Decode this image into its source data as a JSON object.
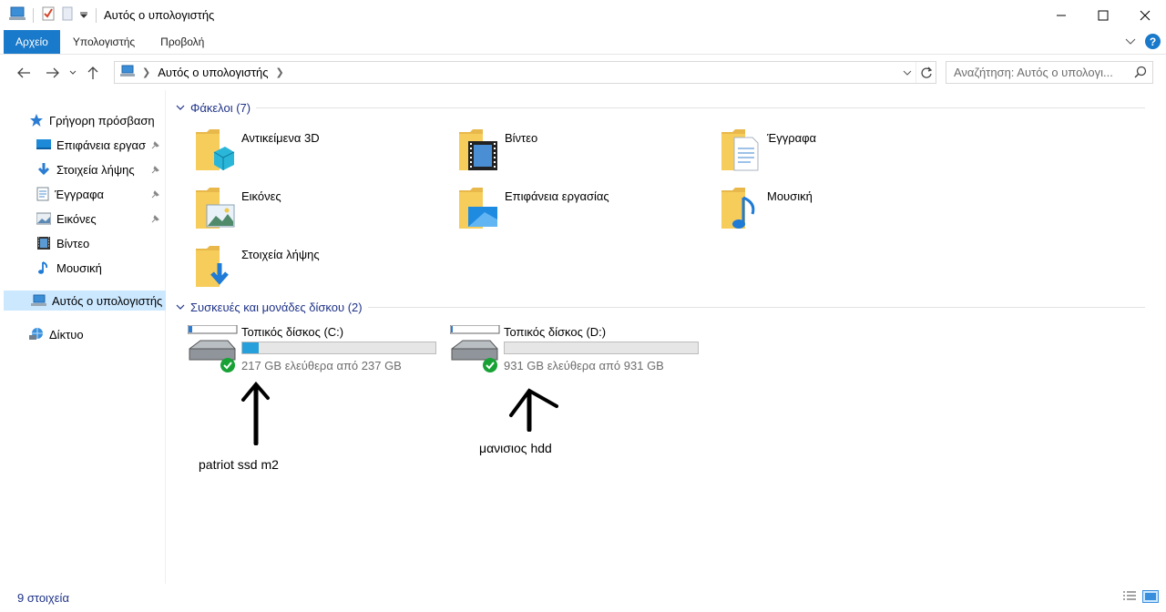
{
  "window": {
    "title": "Αυτός ο υπολογιστής"
  },
  "ribbon": {
    "tabs": [
      "Αρχείο",
      "Υπολογιστής",
      "Προβολή"
    ]
  },
  "address": {
    "path_label": "Αυτός ο υπολογιστής",
    "search_placeholder": "Αναζήτηση: Αυτός ο υπολογι..."
  },
  "nav": {
    "items": [
      {
        "label": "Γρήγορη πρόσβαση",
        "icon": "star-icon",
        "pinned": false
      },
      {
        "label": "Επιφάνεια εργασ",
        "icon": "desktop-icon",
        "pinned": true
      },
      {
        "label": "Στοιχεία λήψης",
        "icon": "download-icon",
        "pinned": true
      },
      {
        "label": "Έγγραφα",
        "icon": "documents-icon",
        "pinned": true
      },
      {
        "label": "Εικόνες",
        "icon": "pictures-icon",
        "pinned": true
      },
      {
        "label": "Βίντεο",
        "icon": "video-icon",
        "pinned": false
      },
      {
        "label": "Μουσική",
        "icon": "music-icon",
        "pinned": false
      },
      {
        "label": "Αυτός ο υπολογιστής",
        "icon": "computer-icon",
        "pinned": false
      },
      {
        "label": "Δίκτυο",
        "icon": "network-icon",
        "pinned": false
      }
    ]
  },
  "folders_group": {
    "header": "Φάκελοι (7)",
    "items": [
      {
        "label": "Αντικείμενα 3D",
        "icon": "folder-3d-icon"
      },
      {
        "label": "Βίντεο",
        "icon": "folder-video-icon"
      },
      {
        "label": "Έγγραφα",
        "icon": "folder-documents-icon"
      },
      {
        "label": "Εικόνες",
        "icon": "folder-pictures-icon"
      },
      {
        "label": "Επιφάνεια εργασίας",
        "icon": "folder-desktop-icon"
      },
      {
        "label": "Μουσική",
        "icon": "folder-music-icon"
      },
      {
        "label": "Στοιχεία λήψης",
        "icon": "folder-downloads-icon"
      }
    ]
  },
  "drives_group": {
    "header": "Συσκευές και μονάδες δίσκου (2)",
    "items": [
      {
        "label": "Τοπικός δίσκος (C:)",
        "free": "217 GB ελεύθερα από 237 GB",
        "used_fraction": 0.084
      },
      {
        "label": "Τοπικός δίσκος (D:)",
        "free": "931 GB ελεύθερα από 931 GB",
        "used_fraction": 0.0
      }
    ]
  },
  "annotations": {
    "c_note": "patriot ssd m2",
    "d_note": "μανισιος hdd"
  },
  "status": {
    "count": "9 στοιχεία"
  },
  "colors": {
    "accent": "#1979ca",
    "group_header": "#1e3287",
    "drive_fill": "#26a0da",
    "folder_yellow": "#f6cd5b"
  }
}
